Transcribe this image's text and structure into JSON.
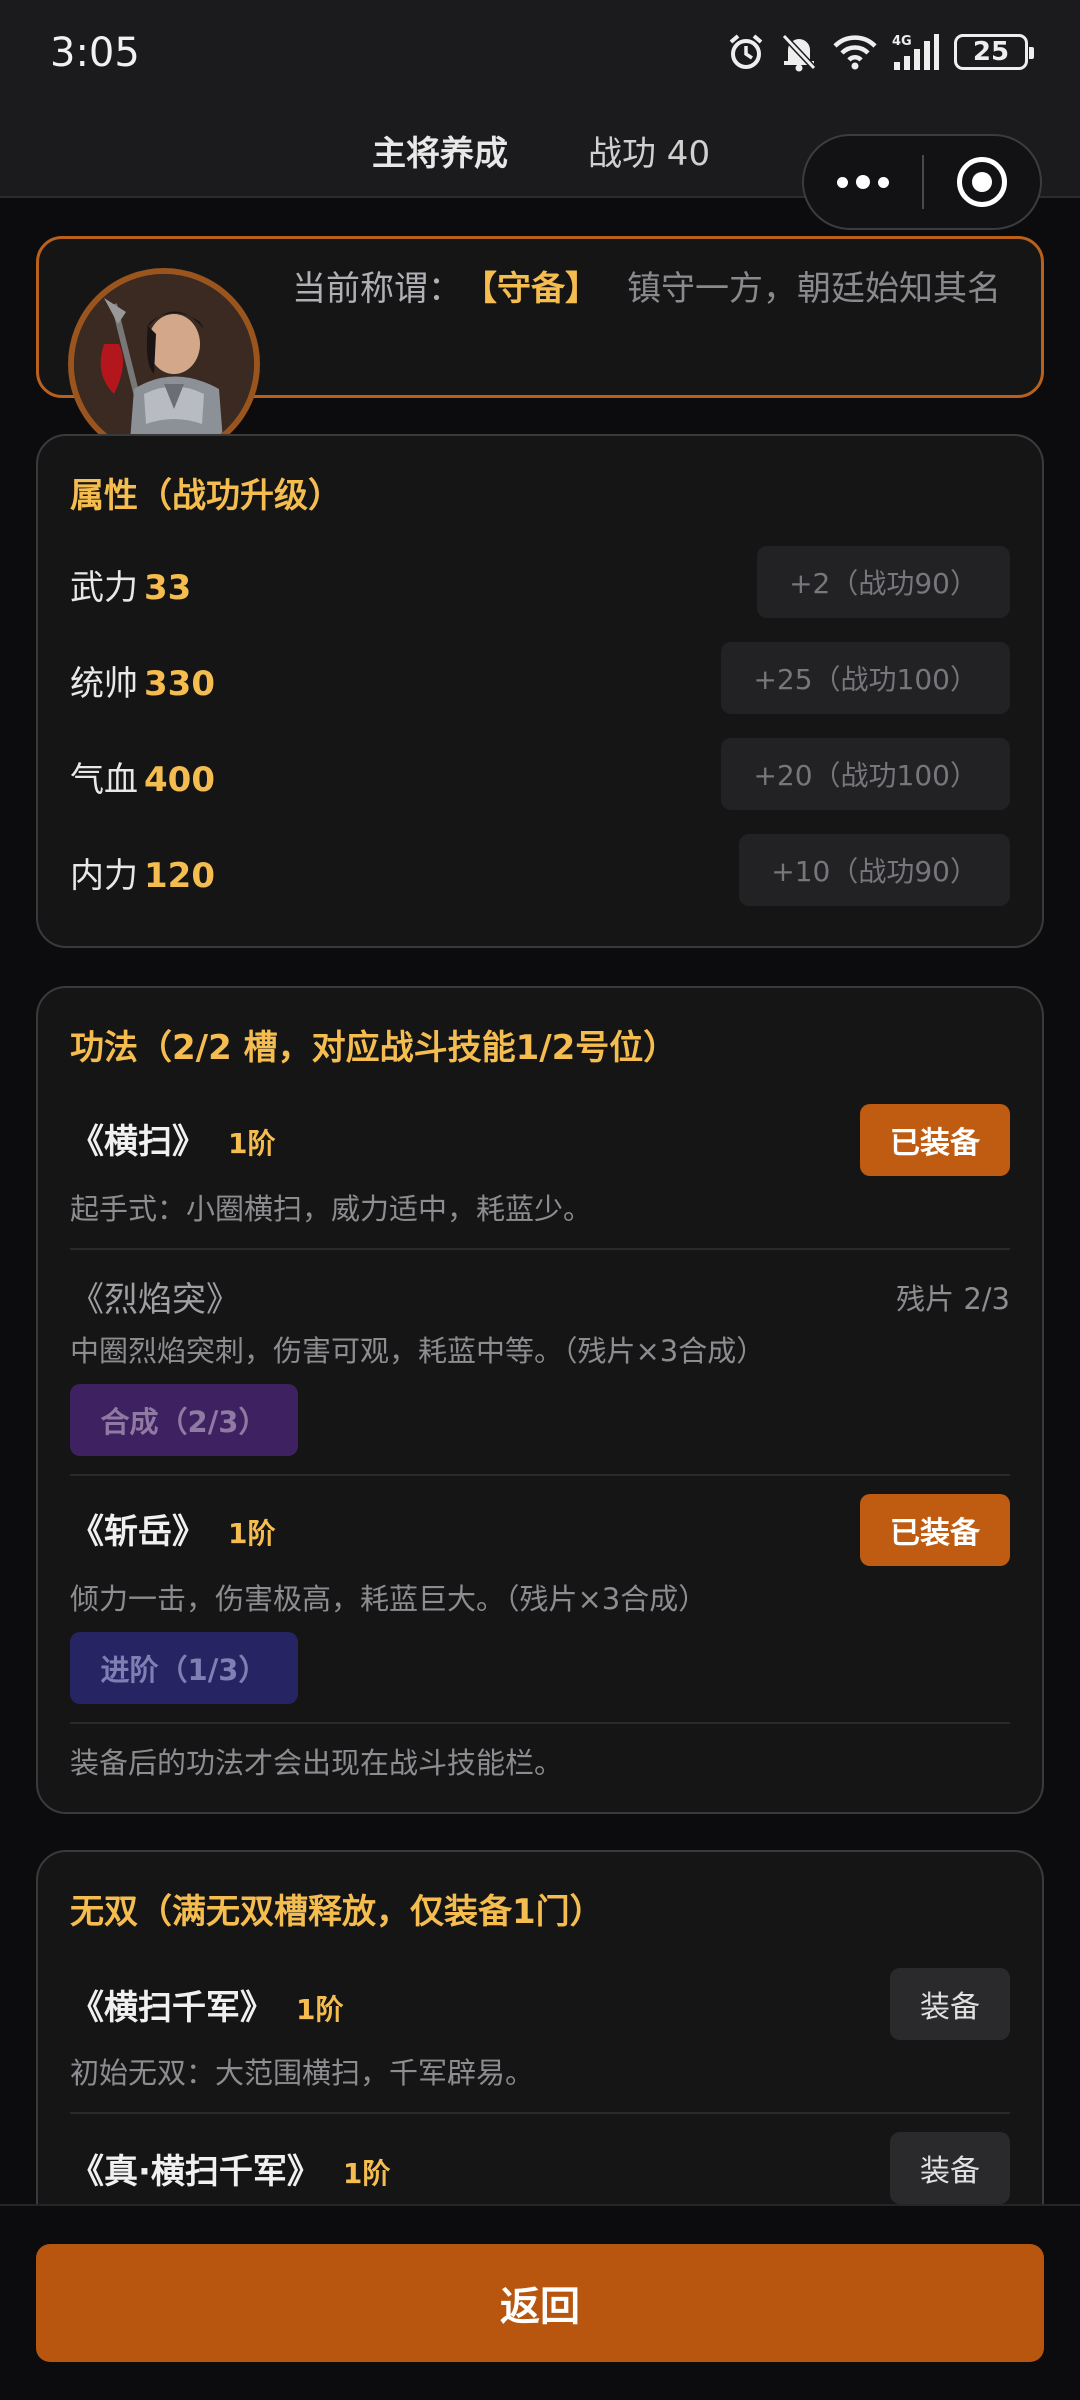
{
  "status": {
    "time": "3:05",
    "battery": "25"
  },
  "nav": {
    "title": "主将养成",
    "merit": "战功 40"
  },
  "title_card": {
    "label": "当前称谓：",
    "rank": "【守备】",
    "desc": "镇守一方，朝廷始知其名"
  },
  "attributes": {
    "title": "属性（战功升级）",
    "items": [
      {
        "name": "武力",
        "value": "33",
        "button": "+2（战功90）"
      },
      {
        "name": "统帅",
        "value": "330",
        "button": "+25（战功100）"
      },
      {
        "name": "气血",
        "value": "400",
        "button": "+20（战功100）"
      },
      {
        "name": "内力",
        "value": "120",
        "button": "+10（战功90）"
      }
    ]
  },
  "skills": {
    "title": "功法（2/2 槽，对应战斗技能1/2号位）",
    "items": [
      {
        "name": "《横扫》",
        "tier": "1阶",
        "button": "已装备",
        "desc": "起手式：小圈横扫，威力适中，耗蓝少。"
      },
      {
        "name": "《烈焰突》",
        "fragments": "残片 2/3",
        "desc": "中圈烈焰突刺，伤害可观，耗蓝中等。（残片×3合成）",
        "action": "合成（2/3）"
      },
      {
        "name": "《斩岳》",
        "tier": "1阶",
        "button": "已装备",
        "desc": "倾力一击，伤害极高，耗蓝巨大。（残片×3合成）",
        "action": "进阶（1/3）"
      }
    ],
    "note": "装备后的功法才会出现在战斗技能栏。"
  },
  "musou": {
    "title": "无双（满无双槽释放，仅装备1门）",
    "items": [
      {
        "name": "《横扫千军》",
        "tier": "1阶",
        "button": "装备",
        "desc": "初始无双：大范围横扫，千军辟易。"
      },
      {
        "name": "《真·横扫千军》",
        "tier": "1阶",
        "button": "装备"
      }
    ]
  },
  "footer": {
    "back": "返回"
  },
  "colors": {
    "accent": "#bf5c11",
    "gold": "#f5bd4f",
    "background": "#0c0c0e"
  }
}
